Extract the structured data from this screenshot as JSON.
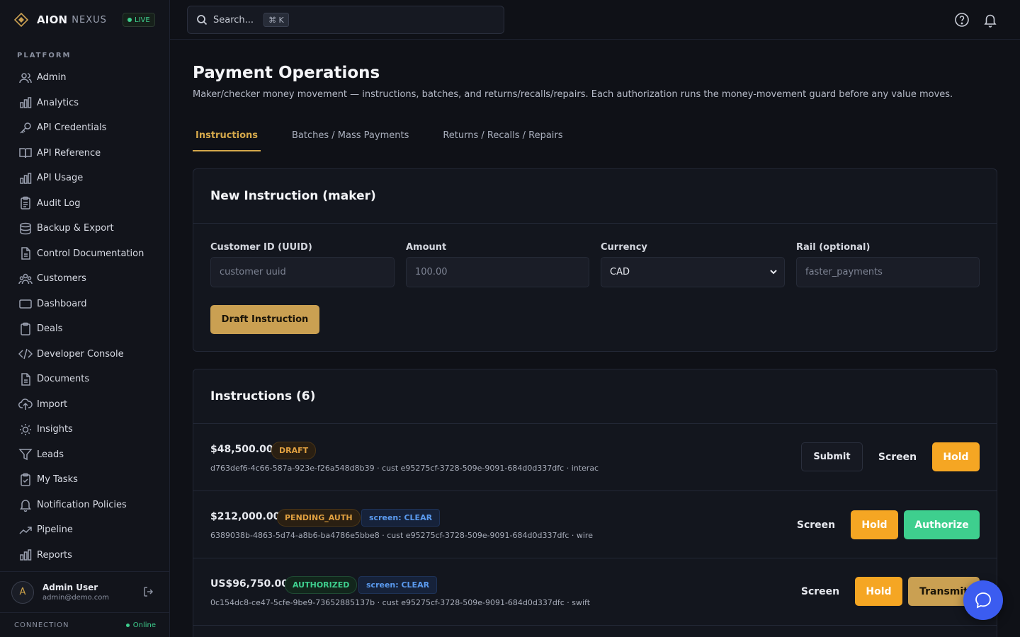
{
  "brand": {
    "name": "AION",
    "sub": "NEXUS",
    "status": "LIVE"
  },
  "sidebar": {
    "section": "PLATFORM",
    "items": [
      {
        "label": "Admin",
        "icon": "users-icon"
      },
      {
        "label": "Analytics",
        "icon": "bar-chart-icon"
      },
      {
        "label": "API Credentials",
        "icon": "key-icon"
      },
      {
        "label": "API Reference",
        "icon": "book-icon"
      },
      {
        "label": "API Usage",
        "icon": "bar-chart-icon"
      },
      {
        "label": "Audit Log",
        "icon": "clipboard-icon"
      },
      {
        "label": "Backup & Export",
        "icon": "database-icon"
      },
      {
        "label": "Control Documentation",
        "icon": "file-icon"
      },
      {
        "label": "Customers",
        "icon": "users-group-icon"
      },
      {
        "label": "Dashboard",
        "icon": "monitor-icon"
      },
      {
        "label": "Deals",
        "icon": "clipboard-icon"
      },
      {
        "label": "Developer Console",
        "icon": "code-icon"
      },
      {
        "label": "Documents",
        "icon": "file-icon"
      },
      {
        "label": "Import",
        "icon": "cloud-upload-icon"
      },
      {
        "label": "Insights",
        "icon": "lightbulb-icon"
      },
      {
        "label": "Leads",
        "icon": "funnel-icon"
      },
      {
        "label": "My Tasks",
        "icon": "clipboard-check-icon"
      },
      {
        "label": "Notification Policies",
        "icon": "bell-icon"
      },
      {
        "label": "Pipeline",
        "icon": "trending-icon"
      },
      {
        "label": "Reports",
        "icon": "bar-chart-icon"
      }
    ],
    "user": {
      "initial": "A",
      "name": "Admin User",
      "email": "admin@demo.com"
    },
    "connection": {
      "label": "CONNECTION",
      "status": "Online"
    }
  },
  "topbar": {
    "search_placeholder": "Search...",
    "shortcut": "⌘ K"
  },
  "page": {
    "title": "Payment Operations",
    "subtitle": "Maker/checker money movement — instructions, batches, and returns/recalls/repairs. Each authorization runs the money-movement guard before any value moves.",
    "tabs": [
      "Instructions",
      "Batches / Mass Payments",
      "Returns / Recalls / Repairs"
    ],
    "active_tab": "Instructions"
  },
  "new_instruction": {
    "title": "New Instruction (maker)",
    "customer_label": "Customer ID (UUID)",
    "customer_placeholder": "customer uuid",
    "amount_label": "Amount",
    "amount_placeholder": "100.00",
    "currency_label": "Currency",
    "currency_value": "CAD",
    "rail_label": "Rail (optional)",
    "rail_placeholder": "faster_payments",
    "draft_button": "Draft Instruction"
  },
  "instructions": {
    "title": "Instructions (6)",
    "rows": [
      {
        "amount": "$48,500.00",
        "status": "DRAFT",
        "screen": "",
        "meta": "d763def6-4c66-587a-923e-f26a548d8b39 · cust e95275cf-3728-509e-9091-684d0d337dfc · interac",
        "actions": [
          "Submit",
          "Screen",
          "Hold"
        ]
      },
      {
        "amount": "$212,000.00",
        "status": "PENDING_AUTH",
        "screen": "screen: CLEAR",
        "meta": "6389038b-4863-5d74-a8b6-ba4786e5bbe8 · cust e95275cf-3728-509e-9091-684d0d337dfc · wire",
        "actions": [
          "Screen",
          "Hold",
          "Authorize"
        ]
      },
      {
        "amount": "US$96,750.00",
        "status": "AUTHORIZED",
        "screen": "screen: CLEAR",
        "meta": "0c154dc8-ce47-5cfe-9be9-73652885137b · cust e95275cf-3728-509e-9091-684d0d337dfc · swift",
        "actions": [
          "Screen",
          "Hold",
          "Transmit"
        ]
      }
    ]
  },
  "colors": {
    "accent": "#caa052",
    "hold": "#f5a623",
    "authorize": "#3ecf8e",
    "chat": "#3b5cf0"
  }
}
